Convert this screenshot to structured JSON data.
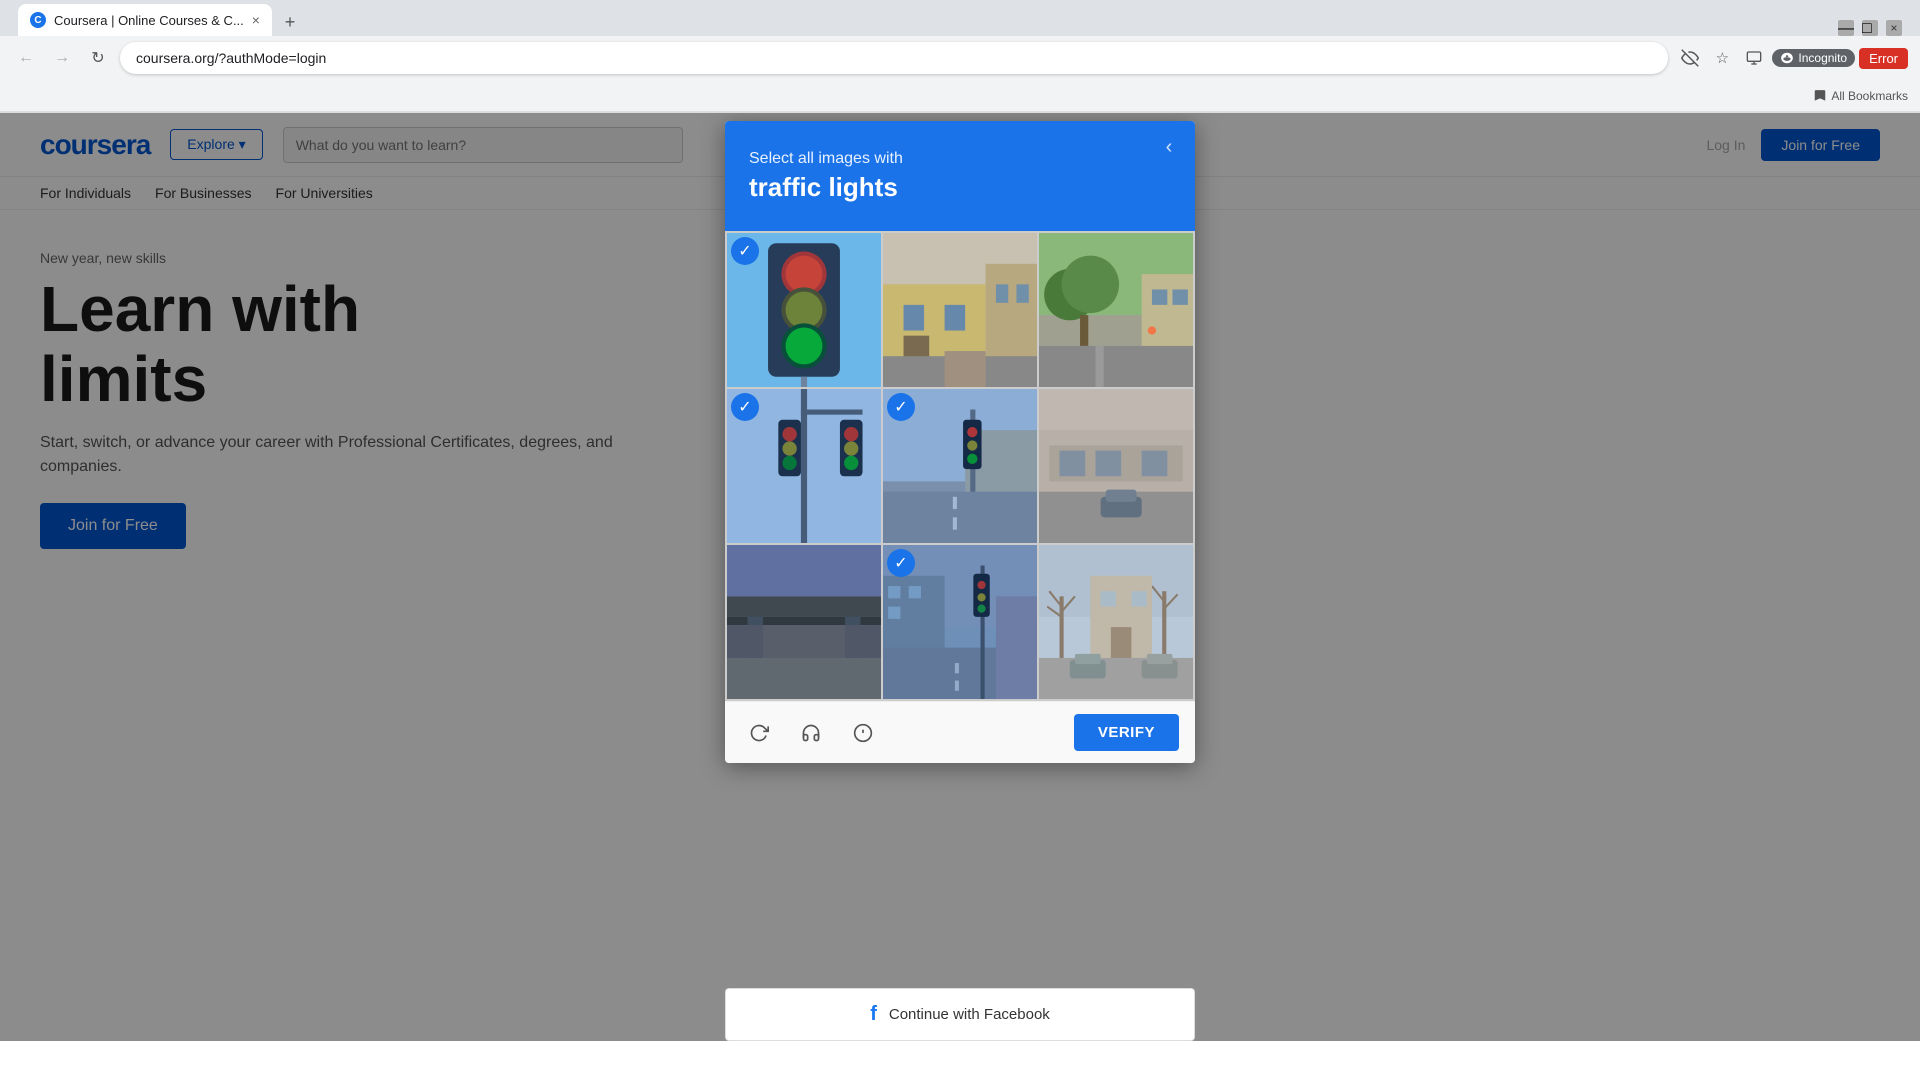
{
  "browser": {
    "tab_favicon": "C",
    "tab_title": "Coursera | Online Courses & C...",
    "tab_close": "×",
    "new_tab": "+",
    "back_disabled": false,
    "forward_disabled": true,
    "url": "coursera.org/?authMode=login",
    "incognito_label": "Incognito",
    "error_label": "Error",
    "bookmarks_label": "All Bookmarks"
  },
  "coursera": {
    "logo": "coursera",
    "explore_label": "Explore ▾",
    "search_placeholder": "What do you want to learn?",
    "nav_items": [
      "Log In",
      "Join for Free"
    ],
    "sub_nav": [
      "For Individuals",
      "For Businesses",
      "For Universities"
    ],
    "hero_subtitle": "New year, new skills",
    "hero_title_line1": "Learn with",
    "hero_title_line2": "limits",
    "hero_desc": "Start, switch, or advance your career with Professional Certificates, degrees, and companies.",
    "hero_cta": "Join for Free"
  },
  "captcha": {
    "subtitle": "Select all images with",
    "title": "traffic lights",
    "close_icon": "‹",
    "cells": [
      {
        "id": 1,
        "selected": true,
        "has_traffic_light": true,
        "label": "traffic light close-up"
      },
      {
        "id": 2,
        "selected": false,
        "has_traffic_light": false,
        "label": "building street"
      },
      {
        "id": 3,
        "selected": false,
        "has_traffic_light": false,
        "label": "street scene trees"
      },
      {
        "id": 4,
        "selected": true,
        "has_traffic_light": true,
        "label": "traffic lights on pole"
      },
      {
        "id": 5,
        "selected": true,
        "has_traffic_light": true,
        "label": "traffic light at intersection"
      },
      {
        "id": 6,
        "selected": false,
        "has_traffic_light": false,
        "label": "building overpass"
      },
      {
        "id": 7,
        "selected": false,
        "has_traffic_light": false,
        "label": "overpass dark"
      },
      {
        "id": 8,
        "selected": true,
        "has_traffic_light": true,
        "label": "street with traffic light"
      },
      {
        "id": 9,
        "selected": false,
        "has_traffic_light": false,
        "label": "suburban street"
      }
    ],
    "footer": {
      "refresh_title": "Get a new challenge",
      "audio_title": "Get an audio challenge",
      "info_title": "Help",
      "verify_label": "VERIFY"
    }
  },
  "facebook_btn": {
    "icon": "f",
    "label": "Continue with Facebook"
  }
}
